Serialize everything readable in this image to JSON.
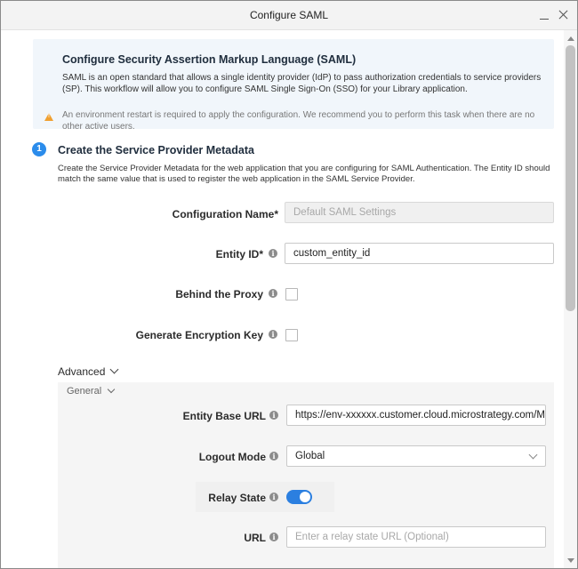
{
  "window": {
    "title": "Configure SAML"
  },
  "banner": {
    "heading": "Configure Security Assertion Markup Language (SAML)",
    "description": "SAML is an open standard that allows a single identity provider (IdP) to pass authorization credentials to service providers (SP). This workflow will allow you to configure SAML Single Sign-On (SSO) for your Library application.",
    "warning": "An environment restart is required to apply the configuration. We recommend you to perform this task when there are no other active users."
  },
  "step1": {
    "number": "1",
    "title": "Create the Service Provider Metadata",
    "description": "Create the Service Provider Metadata for the web application that you are configuring for SAML Authentication. The Entity ID should match the same value that is used to register the web application in the SAML Service Provider."
  },
  "fields": {
    "config_name_label": "Configuration Name*",
    "config_name_placeholder": "Default SAML Settings",
    "entity_id_label": "Entity ID*",
    "entity_id_value": "custom_entity_id",
    "behind_proxy_label": "Behind the Proxy",
    "behind_proxy_checked": false,
    "gen_key_label": "Generate Encryption Key",
    "gen_key_checked": false
  },
  "advanced": {
    "label": "Advanced",
    "general_label": "General",
    "entity_base_url_label": "Entity Base URL",
    "entity_base_url_value": "https://env-xxxxxx.customer.cloud.microstrategy.com/M",
    "logout_mode_label": "Logout Mode",
    "logout_mode_value": "Global",
    "relay_state_label": "Relay State",
    "relay_state_on": true,
    "url_label": "URL",
    "url_placeholder": "Enter a relay state URL (Optional)"
  },
  "info_glyph": "i",
  "colors": {
    "accent": "#2b7fe0",
    "warning": "#f0a030",
    "banner_bg": "#f1f6fb"
  }
}
